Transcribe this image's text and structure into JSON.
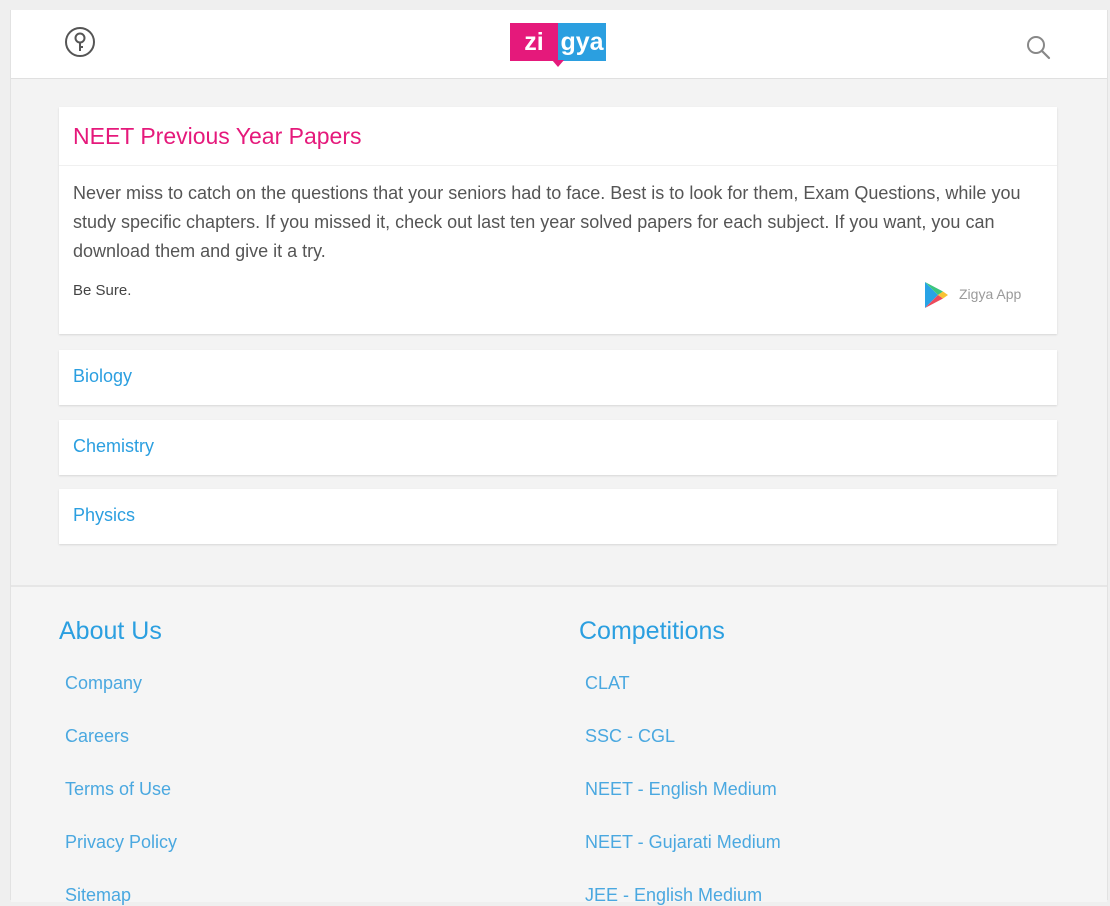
{
  "header": {
    "logo_text_left": "zi",
    "logo_text_right": "gya",
    "help_icon": "help-key-icon",
    "search_icon": "search-icon"
  },
  "intro": {
    "title": "NEET Previous Year Papers",
    "text": "Never miss to catch on the questions that your seniors had to face. Best is to look for them, Exam Questions, while you study specific chapters. If you missed it, check out last ten year solved papers for each subject. If you want, you can download them and give it a try.",
    "tagline": "Be Sure.",
    "app_label": "Zigya App"
  },
  "subjects": [
    "Biology",
    "Chemistry",
    "Physics"
  ],
  "footer": {
    "about": {
      "heading": "About Us",
      "links": [
        "Company",
        "Careers",
        "Terms of Use",
        "Privacy Policy",
        "Sitemap"
      ]
    },
    "competitions": {
      "heading": "Competitions",
      "links": [
        "CLAT",
        "SSC - CGL",
        "NEET - English Medium",
        "NEET - Gujarati Medium",
        "JEE - English Medium"
      ]
    }
  },
  "colors": {
    "brand_pink": "#e5197b",
    "brand_blue": "#2b9fe0"
  }
}
